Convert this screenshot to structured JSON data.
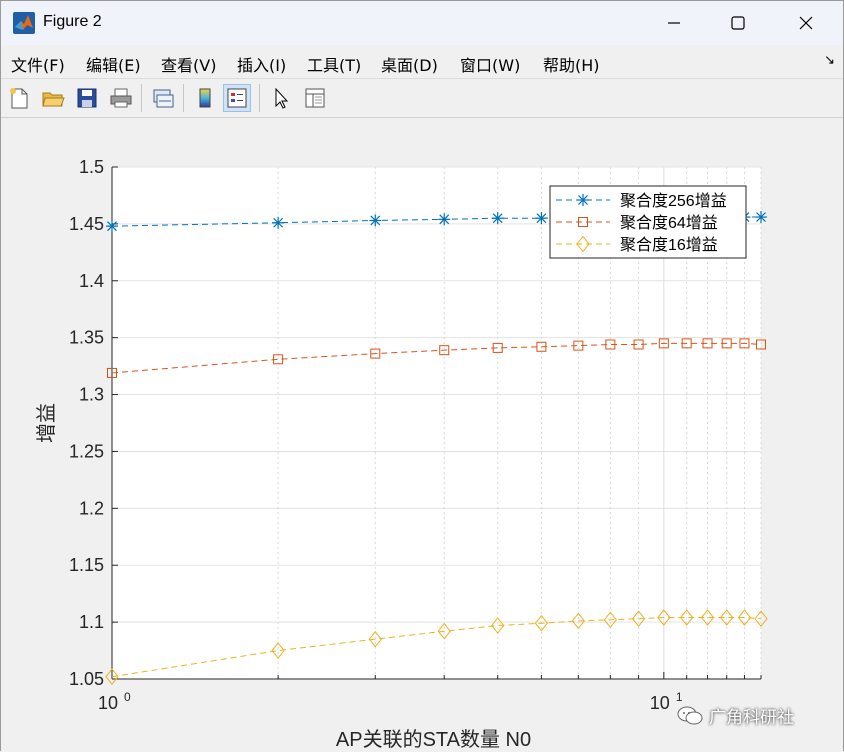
{
  "window": {
    "title": "Figure 2",
    "minimize_glyph": "—",
    "maximize_glyph": "☐",
    "close_glyph": "✕"
  },
  "menu": {
    "items": [
      "文件(F)",
      "编辑(E)",
      "查看(V)",
      "插入(I)",
      "工具(T)",
      "桌面(D)",
      "窗口(W)",
      "帮助(H)"
    ],
    "overflow_glyph": "↘"
  },
  "toolbar": {
    "buttons": [
      "new-figure-icon",
      "open-folder-icon",
      "save-icon",
      "print-icon",
      "link-plot-icon",
      "colorbar-icon",
      "legend-icon",
      "pointer-icon",
      "property-inspector-icon"
    ]
  },
  "watermark": "广角科研社",
  "chart_data": {
    "type": "line",
    "xscale": "log",
    "x": [
      1,
      2,
      3,
      4,
      5,
      6,
      7,
      8,
      9,
      10,
      11,
      12,
      13,
      14,
      15
    ],
    "xlim": [
      1,
      15
    ],
    "ylim": [
      1.05,
      1.5
    ],
    "xlabel": "AP关联的STA数量 N0",
    "ylabel": "增益",
    "xtick_labels": [
      {
        "base": "10",
        "exp": "0",
        "value": 1
      },
      {
        "base": "10",
        "exp": "1",
        "value": 10
      }
    ],
    "yticks": [
      "1.05",
      "1.1",
      "1.15",
      "1.2",
      "1.25",
      "1.3",
      "1.35",
      "1.4",
      "1.45",
      "1.5"
    ],
    "grid": true,
    "legend_position": "top-right",
    "series": [
      {
        "name": "聚合度256增益",
        "marker": "asterisk",
        "color": "#0072bd",
        "values": [
          1.448,
          1.451,
          1.453,
          1.454,
          1.455,
          1.455,
          1.456,
          1.456,
          1.456,
          1.456,
          1.456,
          1.456,
          1.456,
          1.456,
          1.456
        ]
      },
      {
        "name": "聚合度64增益",
        "marker": "square",
        "color": "#d95319",
        "values": [
          1.319,
          1.331,
          1.336,
          1.339,
          1.341,
          1.342,
          1.343,
          1.344,
          1.344,
          1.345,
          1.345,
          1.345,
          1.345,
          1.345,
          1.344
        ]
      },
      {
        "name": "聚合度16增益",
        "marker": "diamond",
        "color": "#edb120",
        "values": [
          1.052,
          1.075,
          1.085,
          1.092,
          1.097,
          1.099,
          1.101,
          1.102,
          1.103,
          1.104,
          1.104,
          1.104,
          1.104,
          1.104,
          1.103
        ]
      }
    ]
  }
}
